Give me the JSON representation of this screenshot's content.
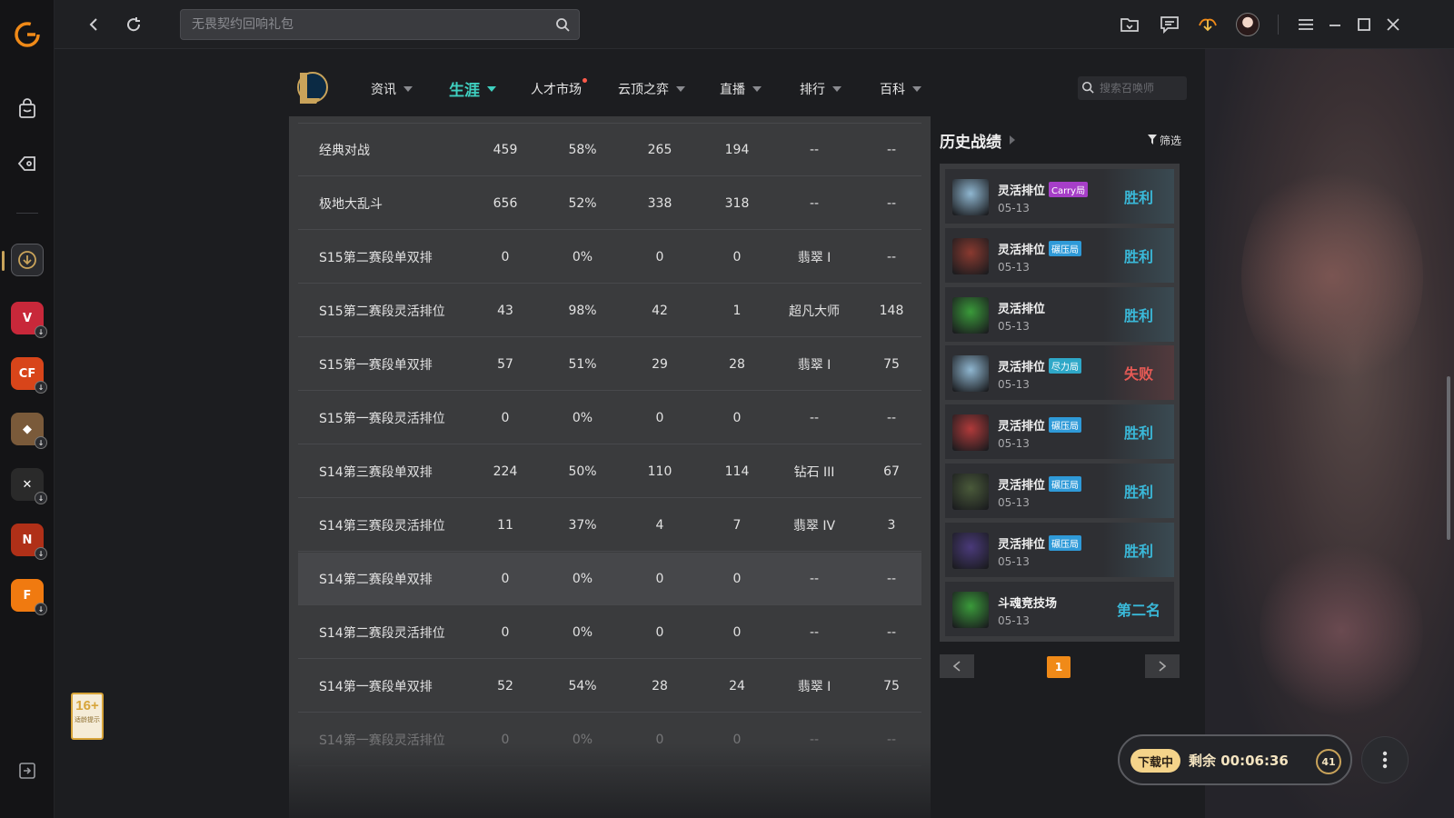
{
  "topbar": {
    "search_placeholder": "无畏契约回响礼包"
  },
  "lol_nav": {
    "items": [
      {
        "label": "资讯",
        "dropdown": true
      },
      {
        "label": "生涯",
        "dropdown": true,
        "active": true
      },
      {
        "label": "人才市场",
        "dropdown": false,
        "dot": true
      },
      {
        "label": "云顶之弈",
        "dropdown": true
      },
      {
        "label": "直播",
        "dropdown": true
      },
      {
        "label": "排行",
        "dropdown": true
      },
      {
        "label": "百科",
        "dropdown": true
      }
    ],
    "summoner_search_placeholder": "搜索召唤师"
  },
  "career_table": {
    "rows": [
      [
        "经典对战",
        "459",
        "58%",
        "265",
        "194",
        "--",
        "--"
      ],
      [
        "极地大乱斗",
        "656",
        "52%",
        "338",
        "318",
        "--",
        "--"
      ],
      [
        "S15第二赛段单双排",
        "0",
        "0%",
        "0",
        "0",
        "翡翠 I",
        "--"
      ],
      [
        "S15第二赛段灵活排位",
        "43",
        "98%",
        "42",
        "1",
        "超凡大师",
        "148"
      ],
      [
        "S15第一赛段单双排",
        "57",
        "51%",
        "29",
        "28",
        "翡翠 I",
        "75"
      ],
      [
        "S15第一赛段灵活排位",
        "0",
        "0%",
        "0",
        "0",
        "--",
        "--"
      ],
      [
        "S14第三赛段单双排",
        "224",
        "50%",
        "110",
        "114",
        "钻石 III",
        "67"
      ],
      [
        "S14第三赛段灵活排位",
        "11",
        "37%",
        "4",
        "7",
        "翡翠 IV",
        "3"
      ],
      [
        "S14第二赛段单双排",
        "0",
        "0%",
        "0",
        "0",
        "--",
        "--"
      ],
      [
        "S14第二赛段灵活排位",
        "0",
        "0%",
        "0",
        "0",
        "--",
        "--"
      ],
      [
        "S14第一赛段单双排",
        "52",
        "54%",
        "28",
        "24",
        "翡翠 I",
        "75"
      ],
      [
        "S14第一赛段灵活排位",
        "0",
        "0%",
        "0",
        "0",
        "--",
        "--"
      ]
    ],
    "highlighted_row": 8
  },
  "history": {
    "title": "历史战绩",
    "filter_label": "筛选",
    "matches": [
      {
        "mode": "灵活排位",
        "tag": "Carry局",
        "tag_color": "#a63ec8",
        "date": "05-13",
        "result": "胜利",
        "result_type": "win",
        "champ_color": "#8fb6d0"
      },
      {
        "mode": "灵活排位",
        "tag": "碾压局",
        "tag_color": "#2f9ad8",
        "date": "05-13",
        "result": "胜利",
        "result_type": "win",
        "champ_color": "#8a3a30"
      },
      {
        "mode": "灵活排位",
        "tag": "",
        "tag_color": "",
        "date": "05-13",
        "result": "胜利",
        "result_type": "win",
        "champ_color": "#3a9a3a"
      },
      {
        "mode": "灵活排位",
        "tag": "尽力局",
        "tag_color": "#2fa8c8",
        "date": "05-13",
        "result": "失败",
        "result_type": "lose",
        "champ_color": "#8fb6d0"
      },
      {
        "mode": "灵活排位",
        "tag": "碾压局",
        "tag_color": "#2f9ad8",
        "date": "05-13",
        "result": "胜利",
        "result_type": "win",
        "champ_color": "#b03a3a"
      },
      {
        "mode": "灵活排位",
        "tag": "碾压局",
        "tag_color": "#2f9ad8",
        "date": "05-13",
        "result": "胜利",
        "result_type": "win",
        "champ_color": "#4a5a3a"
      },
      {
        "mode": "灵活排位",
        "tag": "碾压局",
        "tag_color": "#2f9ad8",
        "date": "05-13",
        "result": "胜利",
        "result_type": "win",
        "champ_color": "#4a3a7a"
      },
      {
        "mode": "斗魂竞技场",
        "tag": "",
        "tag_color": "",
        "date": "05-13",
        "result": "第二名",
        "result_type": "rank",
        "champ_color": "#3a9a3a"
      }
    ],
    "current_page": "1"
  },
  "download": {
    "status": "下载中",
    "remaining": "剩余 00:06:36",
    "count": "41"
  },
  "age_rating": {
    "label": "16+",
    "note": "适龄提示"
  },
  "rail_games": [
    {
      "name": "valorant",
      "glyph": "V",
      "color": "#c8283a"
    },
    {
      "name": "crossfire",
      "glyph": "CF",
      "color": "#d8451a"
    },
    {
      "name": "game-4",
      "glyph": "◆",
      "color": "#7a5a3a"
    },
    {
      "name": "game-5",
      "glyph": "✕",
      "color": "#2a2a2a"
    },
    {
      "name": "nba2k",
      "glyph": "N",
      "color": "#b03018"
    },
    {
      "name": "game-f",
      "glyph": "F",
      "color": "#f07a10"
    }
  ],
  "colors": {
    "accent": "#3fd0c0",
    "win": "#3ab8d8",
    "lose": "#e65a55",
    "page_active": "#f08a18"
  }
}
